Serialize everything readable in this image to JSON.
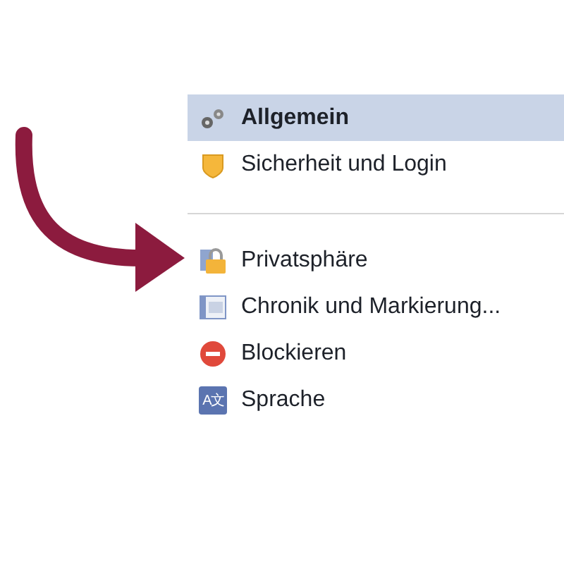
{
  "menu": {
    "groups": [
      {
        "items": [
          {
            "kind": "gears",
            "label": "Allgemein",
            "selected": true
          },
          {
            "kind": "shield",
            "label": "Sicherheit und Login",
            "selected": false
          }
        ]
      },
      {
        "items": [
          {
            "kind": "lock",
            "label": "Privatsphäre",
            "selected": false
          },
          {
            "kind": "timeline",
            "label": "Chronik und Markierung...",
            "selected": false
          },
          {
            "kind": "block",
            "label": "Blockieren",
            "selected": false
          },
          {
            "kind": "language",
            "label": "Sprache",
            "selected": false,
            "glyph": "A文"
          }
        ]
      }
    ]
  }
}
